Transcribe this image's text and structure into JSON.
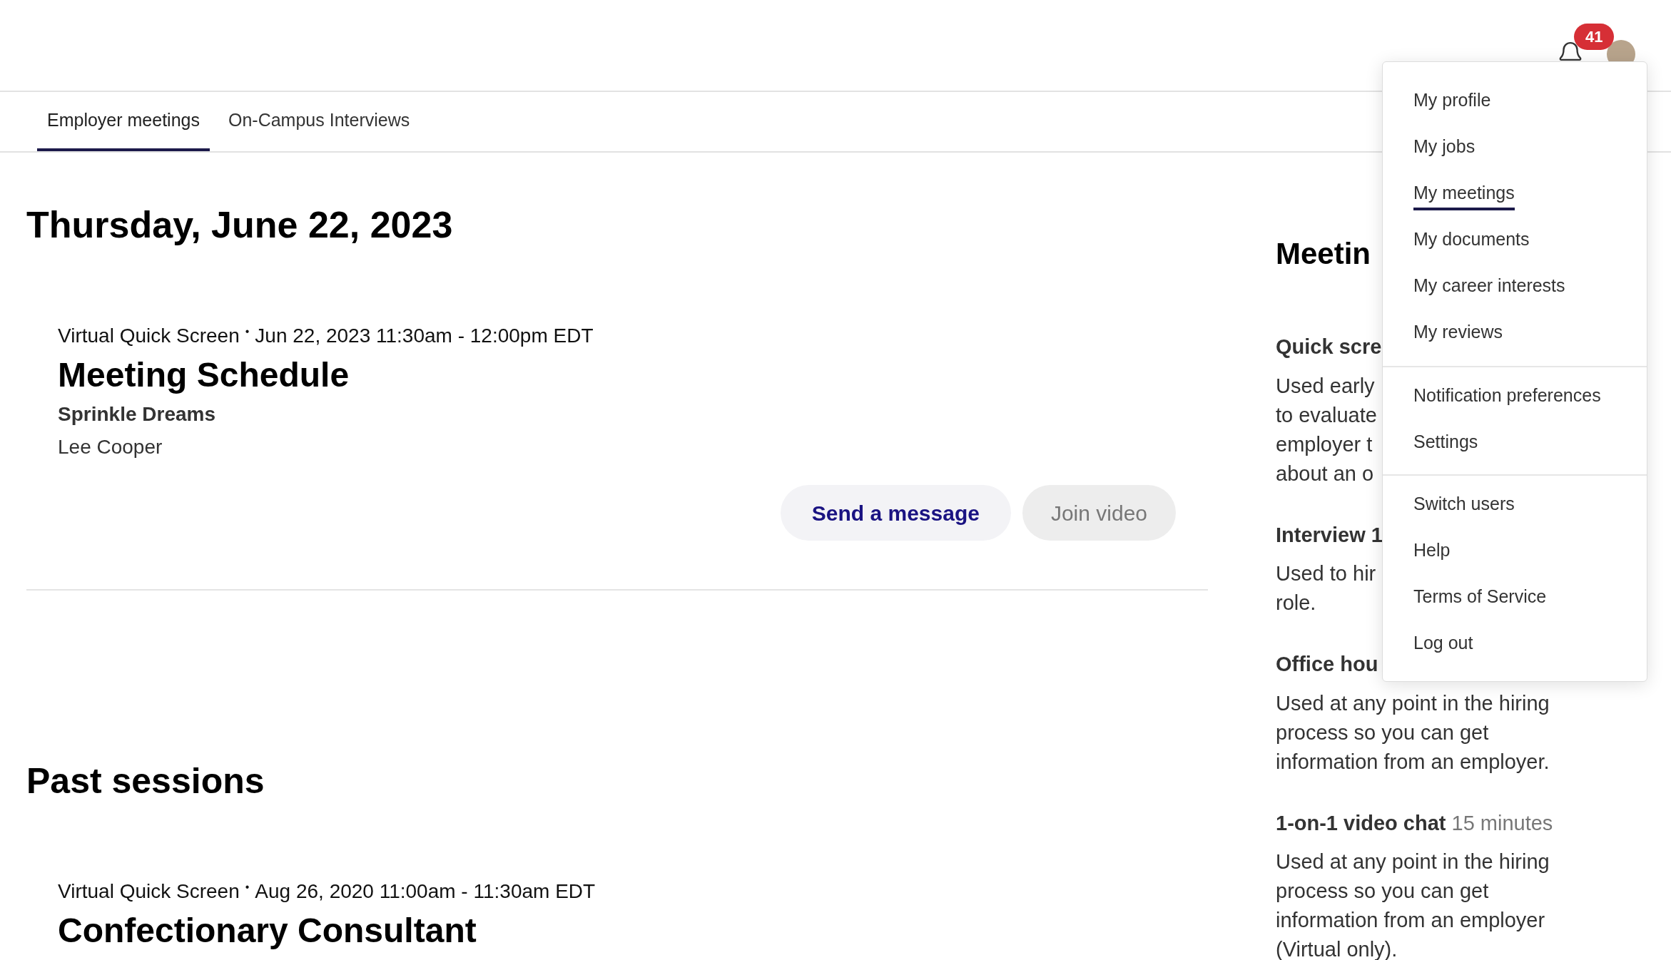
{
  "header": {
    "notification_count": "41"
  },
  "tabs": [
    {
      "label": "Employer meetings",
      "selected": true
    },
    {
      "label": "On-Campus Interviews",
      "selected": false
    }
  ],
  "date_heading": "Thursday, June 22, 2023",
  "upcoming": [
    {
      "type": "Virtual Quick Screen",
      "separator": "•",
      "time": "Jun 22, 2023 11:30am - 12:00pm EDT",
      "title": "Meeting Schedule",
      "employer": "Sprinkle Dreams",
      "person": "Lee Cooper",
      "buttons": [
        {
          "label": "Send a message",
          "disabled": false
        },
        {
          "label": "Join video",
          "disabled": true
        }
      ]
    }
  ],
  "past_heading": "Past sessions",
  "past": [
    {
      "type": "Virtual Quick Screen",
      "separator": "•",
      "time": "Aug 26, 2020 11:00am - 11:30am EDT",
      "title": "Confectionary Consultant"
    }
  ],
  "sidebar": {
    "heading": "Meetin",
    "sections": [
      {
        "title": "Quick scre",
        "lines": [
          "Used early",
          "to evaluate",
          "employer t",
          "about an o"
        ]
      },
      {
        "title": "Interview 1",
        "lines": [
          "Used to hir",
          "role."
        ]
      },
      {
        "title": "Office hou",
        "text": "Used at any point in the hiring process so you can get information from an employer."
      },
      {
        "title": "1-on-1 video chat",
        "duration": "15 minutes",
        "text": "Used at any point in the hiring process so you can get information from an employer (Virtual only)."
      }
    ]
  },
  "menu": {
    "groups": [
      [
        {
          "label": "My profile",
          "selected": false
        },
        {
          "label": "My jobs",
          "selected": false
        },
        {
          "label": "My meetings",
          "selected": true
        },
        {
          "label": "My documents",
          "selected": false
        },
        {
          "label": "My career interests",
          "selected": false
        },
        {
          "label": "My reviews",
          "selected": false
        }
      ],
      [
        {
          "label": "Notification preferences",
          "selected": false
        },
        {
          "label": "Settings",
          "selected": false
        }
      ],
      [
        {
          "label": "Switch users",
          "selected": false
        },
        {
          "label": "Help",
          "selected": false
        },
        {
          "label": "Terms of Service",
          "selected": false
        },
        {
          "label": "Log out",
          "selected": false
        }
      ]
    ]
  }
}
